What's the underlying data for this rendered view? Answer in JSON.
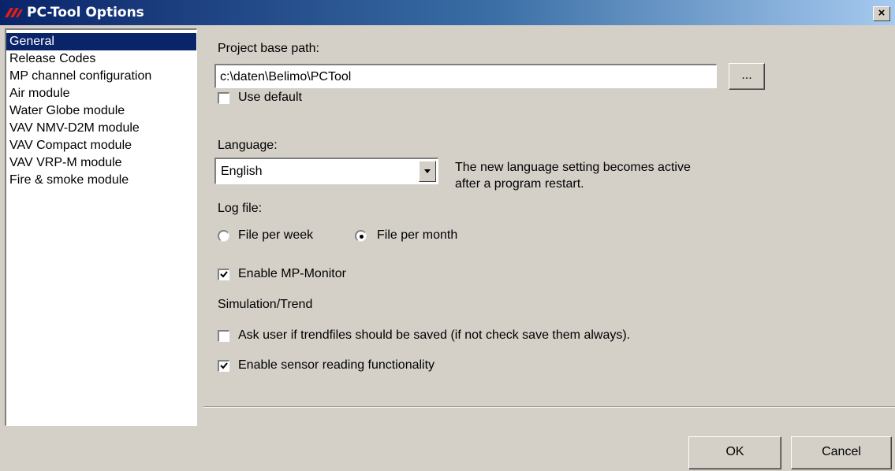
{
  "window": {
    "title": "PC-Tool Options",
    "close_label": "×"
  },
  "nav": {
    "items": [
      {
        "label": "General",
        "selected": true
      },
      {
        "label": "Release Codes"
      },
      {
        "label": "MP channel configuration"
      },
      {
        "label": "Air module"
      },
      {
        "label": "Water Globe module"
      },
      {
        "label": "VAV NMV-D2M module"
      },
      {
        "label": "VAV Compact module"
      },
      {
        "label": "VAV VRP-M module"
      },
      {
        "label": "Fire & smoke module"
      }
    ]
  },
  "general": {
    "project_path_label": "Project base path:",
    "project_path_value": "c:\\daten\\Belimo\\PCTool",
    "browse_label": "...",
    "use_default_label": "Use default",
    "use_default_checked": false,
    "language_label": "Language:",
    "language_value": "English",
    "language_note_line1": "The new language setting becomes active",
    "language_note_line2": "after a program restart.",
    "log_file_label": "Log file:",
    "log_week_label": "File per week",
    "log_month_label": "File per month",
    "log_selected": "File per month",
    "mp_monitor_label": "Enable MP-Monitor",
    "mp_monitor_checked": true,
    "simulation_label": "Simulation/Trend",
    "ask_trend_label": "Ask user if trendfiles should be saved (if not check save them always).",
    "ask_trend_checked": false,
    "sensor_label": "Enable sensor reading functionality",
    "sensor_checked": true
  },
  "footer": {
    "ok_label": "OK",
    "cancel_label": "Cancel"
  },
  "colors": {
    "title_start": "#0a246a",
    "title_end": "#a6caf0",
    "selection": "#0a246a",
    "face": "#d4d0c8"
  }
}
